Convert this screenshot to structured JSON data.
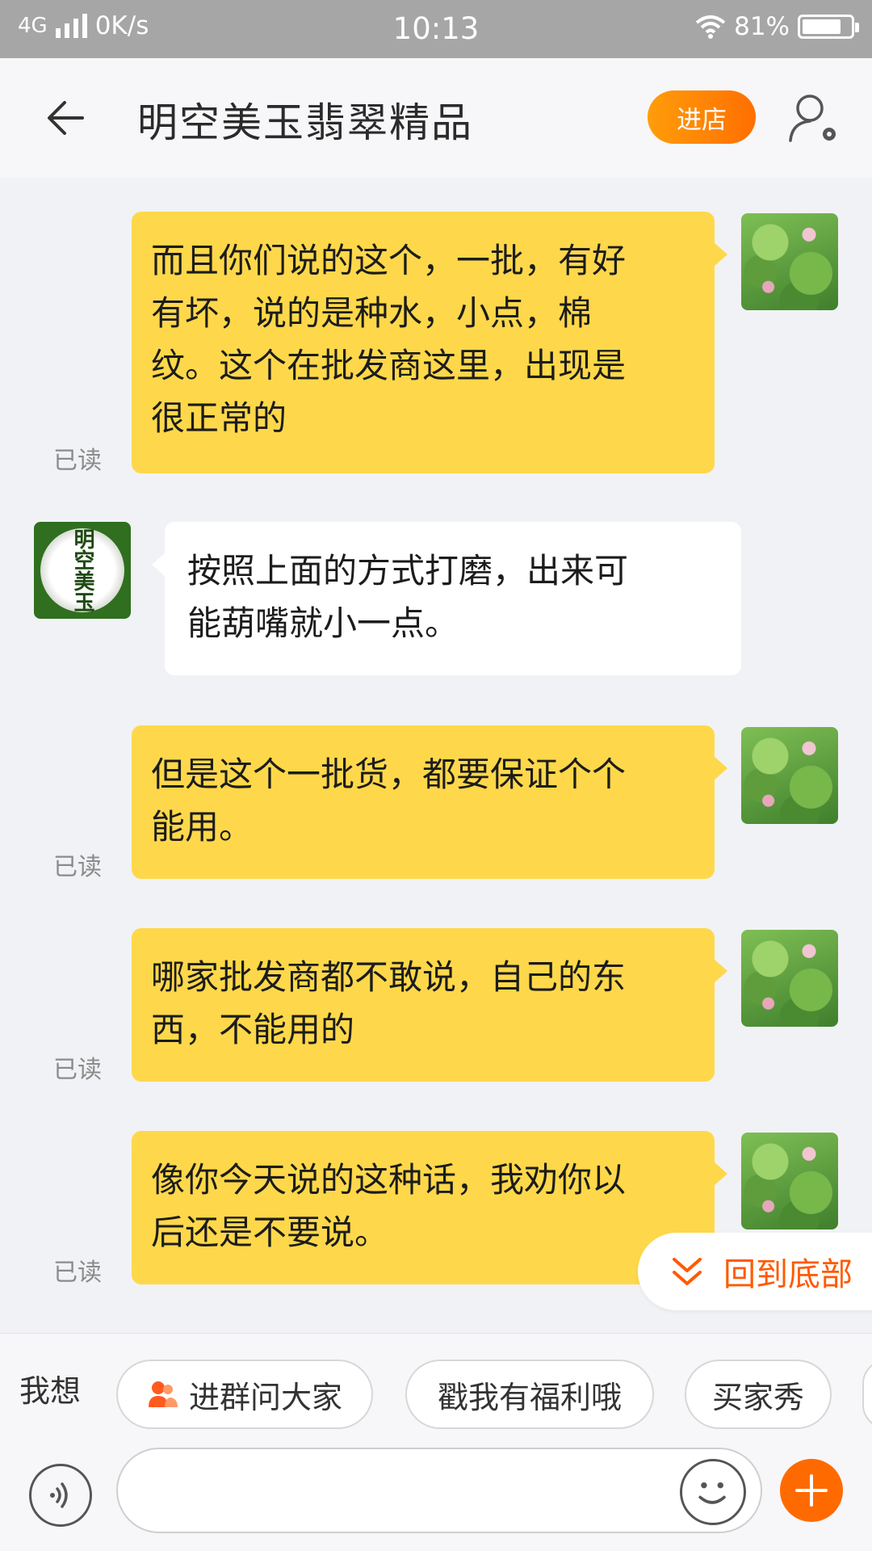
{
  "status_bar": {
    "network": "4G",
    "speed": "0K/s",
    "time": "10:13",
    "battery": "81%",
    "battery_level": 0.81
  },
  "header": {
    "title": "明空美玉翡翠精品",
    "shop_button": "进店",
    "icons": [
      "back-arrow-icon",
      "profile-settings-icon"
    ]
  },
  "messages": [
    {
      "side": "mine",
      "read": "已读",
      "lines": [
        "而且你们说的这个，一批，有好",
        "有坏，说的是种水，小点，棉",
        "纹。这个在批发商这里，出现是",
        "很正常的"
      ]
    },
    {
      "side": "theirs",
      "avatar_text": "明空美玉",
      "lines": [
        "按照上面的方式打磨，出来可",
        "能葫嘴就小一点。"
      ]
    },
    {
      "side": "mine",
      "read": "已读",
      "lines": [
        "但是这个一批货，都要保证个个",
        "能用。"
      ]
    },
    {
      "side": "mine",
      "read": "已读",
      "lines": [
        "哪家批发商都不敢说，自己的东",
        "西，不能用的"
      ]
    },
    {
      "side": "mine",
      "read": "已读",
      "lines": [
        "像你今天说的这种话，我劝你以",
        "后还是不要说。"
      ]
    }
  ],
  "back_to_bottom": "回到底部",
  "quick_replies": {
    "label": "我想",
    "chips": [
      "进群问大家",
      "戳我有福利哦",
      "买家秀"
    ]
  },
  "input": {
    "placeholder": ""
  },
  "colors": {
    "accent": "#ff6a00",
    "my_bubble": "#fed84a"
  }
}
